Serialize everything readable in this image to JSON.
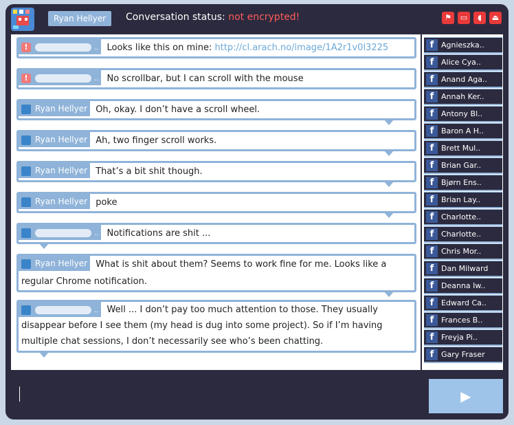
{
  "header": {
    "user_name": "Ryan Hellyer",
    "status_label": "Conversation status:",
    "status_value": "not encrypted!",
    "icons": [
      "alert-icon",
      "chat-icon",
      "sound-icon",
      "eject-icon"
    ]
  },
  "messages": [
    {
      "sender": "",
      "kind": "warn",
      "text": "Looks like this on mine: ",
      "link": "http://cl.arach.no/image/1A2r1v0l3225"
    },
    {
      "sender": "",
      "kind": "warn",
      "text": "No scrollbar, but I can scroll with the mouse"
    },
    {
      "sender": "Ryan Hellyer",
      "kind": "self",
      "text": "Oh, okay. I don’t have a scroll wheel."
    },
    {
      "sender": "Ryan Hellyer",
      "kind": "self",
      "text": "Ah, two finger scroll works."
    },
    {
      "sender": "Ryan Hellyer",
      "kind": "self",
      "text": "That’s a bit shit though."
    },
    {
      "sender": "Ryan Hellyer",
      "kind": "self",
      "text": "poke"
    },
    {
      "sender": "",
      "kind": "other",
      "text": "Notifications are shit ..."
    },
    {
      "sender": "Ryan Hellyer",
      "kind": "self",
      "text": "What is shit about them? Seems to work fine for me. Looks like a regular Chrome notification."
    },
    {
      "sender": "",
      "kind": "other",
      "text": "Well ... I don’t pay too much attention to those. They usually disappear before I see them (my head is dug into some project). So if I’m having multiple chat sessions, I don’t necessarily see who’s been chatting."
    }
  ],
  "contacts": [
    "Agnieszka..",
    "Alice Cya..",
    "Anand Aga..",
    "Annah Ker..",
    "Antony Bl..",
    "Baron A H..",
    "Brett Mul..",
    "Brian Gar..",
    "Bjørn Ens..",
    "Brian Lay..",
    "Charlotte..",
    "Charlotte..",
    "Chris Mor..",
    "Dan Milward",
    "Deanna Iw..",
    "Edward Ca..",
    "Frances B..",
    "Freyja Pi..",
    "Gary Fraser"
  ],
  "input": {
    "value": ""
  },
  "send": {
    "icon": "send-icon",
    "glyph": "▶"
  }
}
